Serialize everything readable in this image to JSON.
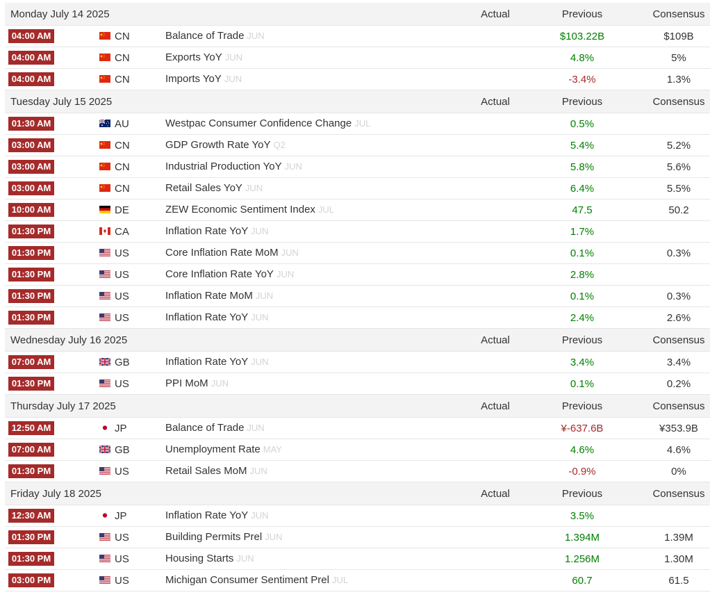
{
  "headers": {
    "actual": "Actual",
    "previous": "Previous",
    "consensus": "Consensus"
  },
  "colors": {
    "time_badge": "#a52a2a",
    "positive": "#008000",
    "negative": "#a52a2a",
    "ref": "#d3d3d3"
  },
  "days": [
    {
      "date": "Monday July 14 2025",
      "events": [
        {
          "time": "04:00 AM",
          "flag": "cn-flag-icon",
          "country": "CN",
          "event": "Balance of Trade",
          "ref": "JUN",
          "actual": "",
          "previous": "$103.22B",
          "previous_color": "green",
          "consensus": "$109B"
        },
        {
          "time": "04:00 AM",
          "flag": "cn-flag-icon",
          "country": "CN",
          "event": "Exports YoY",
          "ref": "JUN",
          "actual": "",
          "previous": "4.8%",
          "previous_color": "green",
          "consensus": "5%"
        },
        {
          "time": "04:00 AM",
          "flag": "cn-flag-icon",
          "country": "CN",
          "event": "Imports YoY",
          "ref": "JUN",
          "actual": "",
          "previous": "-3.4%",
          "previous_color": "red",
          "consensus": "1.3%"
        }
      ]
    },
    {
      "date": "Tuesday July 15 2025",
      "events": [
        {
          "time": "01:30 AM",
          "flag": "au-flag-icon",
          "country": "AU",
          "event": "Westpac Consumer Confidence Change",
          "ref": "JUL",
          "actual": "",
          "previous": "0.5%",
          "previous_color": "green",
          "consensus": ""
        },
        {
          "time": "03:00 AM",
          "flag": "cn-flag-icon",
          "country": "CN",
          "event": "GDP Growth Rate YoY",
          "ref": "Q2",
          "actual": "",
          "previous": "5.4%",
          "previous_color": "green",
          "consensus": "5.2%"
        },
        {
          "time": "03:00 AM",
          "flag": "cn-flag-icon",
          "country": "CN",
          "event": "Industrial Production YoY",
          "ref": "JUN",
          "actual": "",
          "previous": "5.8%",
          "previous_color": "green",
          "consensus": "5.6%"
        },
        {
          "time": "03:00 AM",
          "flag": "cn-flag-icon",
          "country": "CN",
          "event": "Retail Sales YoY",
          "ref": "JUN",
          "actual": "",
          "previous": "6.4%",
          "previous_color": "green",
          "consensus": "5.5%"
        },
        {
          "time": "10:00 AM",
          "flag": "de-flag-icon",
          "country": "DE",
          "event": "ZEW Economic Sentiment Index",
          "ref": "JUL",
          "actual": "",
          "previous": "47.5",
          "previous_color": "green",
          "consensus": "50.2"
        },
        {
          "time": "01:30 PM",
          "flag": "ca-flag-icon",
          "country": "CA",
          "event": "Inflation Rate YoY",
          "ref": "JUN",
          "actual": "",
          "previous": "1.7%",
          "previous_color": "green",
          "consensus": ""
        },
        {
          "time": "01:30 PM",
          "flag": "us-flag-icon",
          "country": "US",
          "event": "Core Inflation Rate MoM",
          "ref": "JUN",
          "actual": "",
          "previous": "0.1%",
          "previous_color": "green",
          "consensus": "0.3%"
        },
        {
          "time": "01:30 PM",
          "flag": "us-flag-icon",
          "country": "US",
          "event": "Core Inflation Rate YoY",
          "ref": "JUN",
          "actual": "",
          "previous": "2.8%",
          "previous_color": "green",
          "consensus": ""
        },
        {
          "time": "01:30 PM",
          "flag": "us-flag-icon",
          "country": "US",
          "event": "Inflation Rate MoM",
          "ref": "JUN",
          "actual": "",
          "previous": "0.1%",
          "previous_color": "green",
          "consensus": "0.3%"
        },
        {
          "time": "01:30 PM",
          "flag": "us-flag-icon",
          "country": "US",
          "event": "Inflation Rate YoY",
          "ref": "JUN",
          "actual": "",
          "previous": "2.4%",
          "previous_color": "green",
          "consensus": "2.6%"
        }
      ]
    },
    {
      "date": "Wednesday July 16 2025",
      "events": [
        {
          "time": "07:00 AM",
          "flag": "gb-flag-icon",
          "country": "GB",
          "event": "Inflation Rate YoY",
          "ref": "JUN",
          "actual": "",
          "previous": "3.4%",
          "previous_color": "green",
          "consensus": "3.4%"
        },
        {
          "time": "01:30 PM",
          "flag": "us-flag-icon",
          "country": "US",
          "event": "PPI MoM",
          "ref": "JUN",
          "actual": "",
          "previous": "0.1%",
          "previous_color": "green",
          "consensus": "0.2%"
        }
      ]
    },
    {
      "date": "Thursday July 17 2025",
      "events": [
        {
          "time": "12:50 AM",
          "flag": "jp-flag-icon",
          "country": "JP",
          "event": "Balance of Trade",
          "ref": "JUN",
          "actual": "",
          "previous": "¥-637.6B",
          "previous_color": "red",
          "consensus": "¥353.9B"
        },
        {
          "time": "07:00 AM",
          "flag": "gb-flag-icon",
          "country": "GB",
          "event": "Unemployment Rate",
          "ref": "MAY",
          "actual": "",
          "previous": "4.6%",
          "previous_color": "green",
          "consensus": "4.6%"
        },
        {
          "time": "01:30 PM",
          "flag": "us-flag-icon",
          "country": "US",
          "event": "Retail Sales MoM",
          "ref": "JUN",
          "actual": "",
          "previous": "-0.9%",
          "previous_color": "red",
          "consensus": "0%"
        }
      ]
    },
    {
      "date": "Friday July 18 2025",
      "events": [
        {
          "time": "12:30 AM",
          "flag": "jp-flag-icon",
          "country": "JP",
          "event": "Inflation Rate YoY",
          "ref": "JUN",
          "actual": "",
          "previous": "3.5%",
          "previous_color": "green",
          "consensus": ""
        },
        {
          "time": "01:30 PM",
          "flag": "us-flag-icon",
          "country": "US",
          "event": "Building Permits Prel",
          "ref": "JUN",
          "actual": "",
          "previous": "1.394M",
          "previous_color": "green",
          "consensus": "1.39M"
        },
        {
          "time": "01:30 PM",
          "flag": "us-flag-icon",
          "country": "US",
          "event": "Housing Starts",
          "ref": "JUN",
          "actual": "",
          "previous": "1.256M",
          "previous_color": "green",
          "consensus": "1.30M"
        },
        {
          "time": "03:00 PM",
          "flag": "us-flag-icon",
          "country": "US",
          "event": "Michigan Consumer Sentiment Prel",
          "ref": "JUL",
          "actual": "",
          "previous": "60.7",
          "previous_color": "green",
          "consensus": "61.5"
        }
      ]
    }
  ]
}
